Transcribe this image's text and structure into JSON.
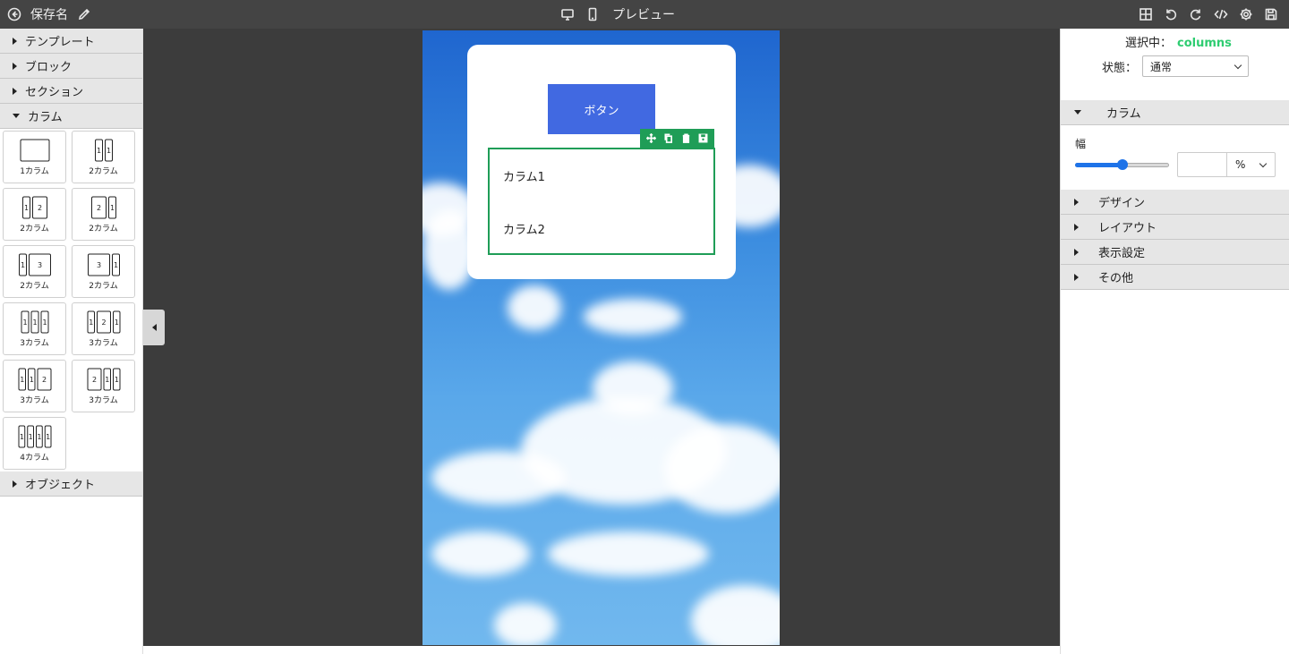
{
  "header": {
    "save_name": "保存名",
    "preview_label": "プレビュー"
  },
  "left_panel": {
    "sections": [
      {
        "label": "テンプレート",
        "expanded": false
      },
      {
        "label": "ブロック",
        "expanded": false
      },
      {
        "label": "セクション",
        "expanded": false
      },
      {
        "label": "カラム",
        "expanded": true
      },
      {
        "label": "オブジェクト",
        "expanded": false
      }
    ],
    "column_layouts": [
      {
        "caption": "1カラム",
        "cols": [
          ""
        ],
        "ratios": [
          1
        ]
      },
      {
        "caption": "2カラム",
        "cols": [
          "1",
          "1"
        ],
        "ratios": [
          1,
          1
        ]
      },
      {
        "caption": "2カラム",
        "cols": [
          "1",
          "2"
        ],
        "ratios": [
          1,
          2
        ]
      },
      {
        "caption": "2カラム",
        "cols": [
          "2",
          "1"
        ],
        "ratios": [
          2,
          1
        ]
      },
      {
        "caption": "2カラム",
        "cols": [
          "1",
          "3"
        ],
        "ratios": [
          1,
          3
        ]
      },
      {
        "caption": "2カラム",
        "cols": [
          "3",
          "1"
        ],
        "ratios": [
          3,
          1
        ]
      },
      {
        "caption": "3カラム",
        "cols": [
          "1",
          "1",
          "1"
        ],
        "ratios": [
          1,
          1,
          1
        ]
      },
      {
        "caption": "3カラム",
        "cols": [
          "1",
          "2",
          "1"
        ],
        "ratios": [
          1,
          2,
          1
        ]
      },
      {
        "caption": "3カラム",
        "cols": [
          "1",
          "1",
          "2"
        ],
        "ratios": [
          1,
          1,
          2
        ]
      },
      {
        "caption": "3カラム",
        "cols": [
          "2",
          "1",
          "1"
        ],
        "ratios": [
          2,
          1,
          1
        ]
      },
      {
        "caption": "4カラム",
        "cols": [
          "1",
          "1",
          "1",
          "1"
        ],
        "ratios": [
          1,
          1,
          1,
          1
        ]
      }
    ]
  },
  "canvas": {
    "button_label": "ボタン",
    "column1": "カラム1",
    "column2": "カラム2",
    "selection_color": "#1f9d57",
    "button_color": "#4169e1"
  },
  "right_panel": {
    "selected_label": "選択中：",
    "selected_value": "columns",
    "state_label": "状態：",
    "state_value": "通常",
    "sections": {
      "column": "カラム",
      "design": "デザイン",
      "layout": "レイアウト",
      "display": "表示設定",
      "other": "その他"
    },
    "width_label": "幅",
    "width_value": "",
    "width_unit": "%",
    "slider_level": 0.5
  }
}
